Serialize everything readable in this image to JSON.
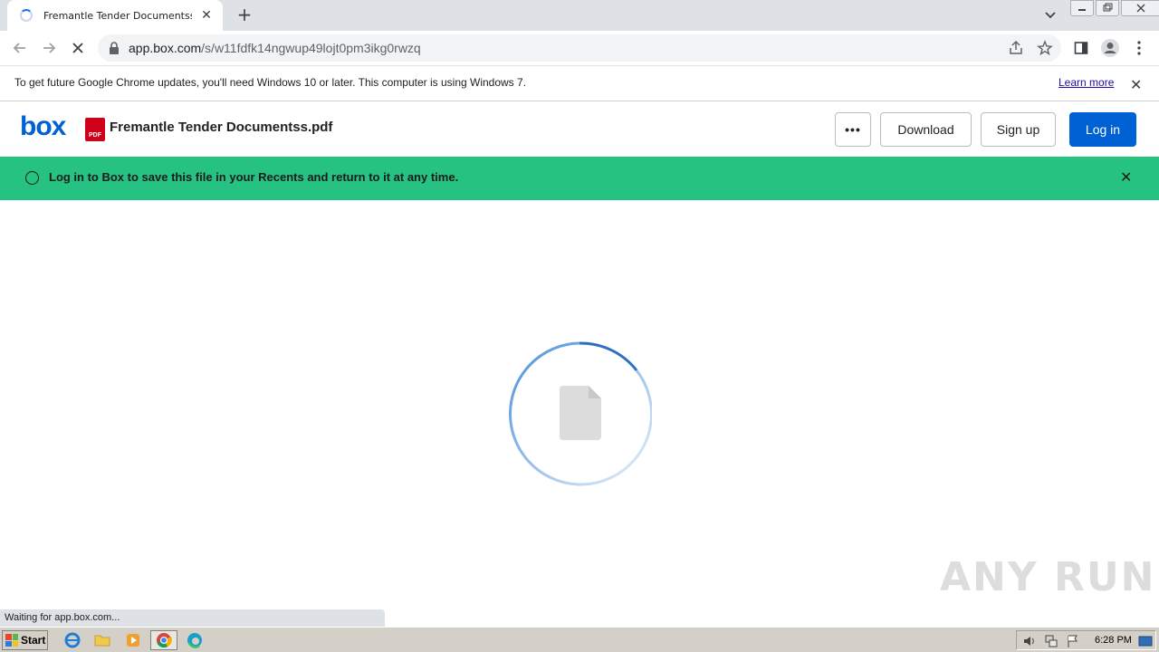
{
  "browser": {
    "tab_title": "Fremantle Tender Documentss.pdf | Powered by Box",
    "new_tab_label": "+",
    "url_host": "app.box.com",
    "url_path": "/s/w11fdfk14ngwup49lojt0pm3ikg0rwzq"
  },
  "infobar": {
    "message": "To get future Google Chrome updates, you'll need Windows 10 or later. This computer is using Windows 7.",
    "learn_more": "Learn more"
  },
  "box_header": {
    "logo": "box",
    "file_icon_label": "PDF",
    "file_name": "Fremantle Tender Documentss.pdf",
    "more_label": "•••",
    "download_label": "Download",
    "signup_label": "Sign up",
    "login_label": "Log in"
  },
  "banner": {
    "message": "Log in to Box to save this file in your Recents and return to it at any time."
  },
  "status": {
    "text": "Waiting for app.box.com..."
  },
  "watermark": {
    "text": "ANY RUN"
  },
  "taskbar": {
    "start_label": "Start",
    "clock": "6:28 PM"
  },
  "colors": {
    "box_blue": "#0061d5",
    "banner_green": "#26c281",
    "pdf_red": "#d0021b"
  }
}
